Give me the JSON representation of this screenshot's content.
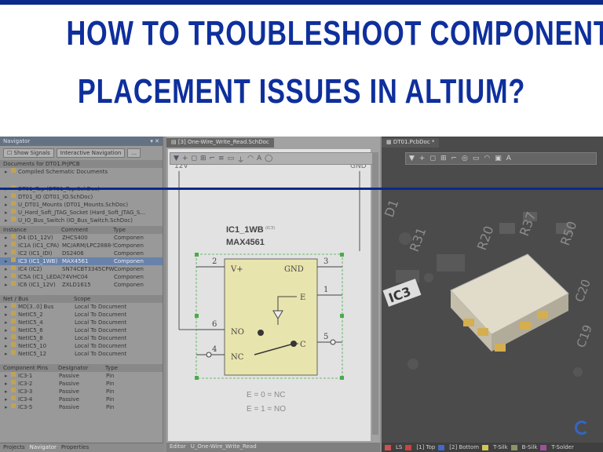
{
  "title": {
    "line1": "HOW TO TROUBLESHOOT COMPONENT",
    "line2": "PLACEMENT ISSUES IN ALTIUM?"
  },
  "colors": {
    "title": "#0e2f9c",
    "rule": "#0b2a8a",
    "selection": "#5f7fb0",
    "pcb_component": "#e8e2cc"
  },
  "navigator": {
    "header": "Navigator",
    "show_signals": "Show Signals",
    "interactive_nav": "Interactive Navigation",
    "more": "...",
    "documents_header": "Documents for DT01.PrjPCB",
    "compiled": "Compiled  Schematic Documents",
    "docs": [
      "DT01_Top (DT01_Top.SchDoc)",
      "DT01_IO (DT01_IO.SchDoc)",
      "U_DT01_Mounts (DT01_Mounts.SchDoc)",
      "U_Hard_Soft_JTAG_Socket (Hard_Soft_JTAG_S...",
      "U_IO_Bus_Switch (IO_Bus_Switch.SchDoc)"
    ],
    "instance_headers": [
      "Instance",
      "Comment",
      "Type"
    ],
    "instances": [
      [
        "D4 (D1_12V)",
        "ZHCS400",
        "Componen"
      ],
      [
        "IC1A (IC1_CPA)",
        "MC/ARM/LPC2888-5",
        "Componen"
      ],
      [
        "IC2 (IC1_IDI)",
        "DS2406",
        "Componen"
      ],
      [
        "IC3 (IC1_1WB)",
        "MAX4561",
        "Componen"
      ],
      [
        "IC4 (IC2)",
        "SN74CBT3345CPWR",
        "Componen"
      ],
      [
        "IC5A (IC1_LEDA)",
        "74VHC04",
        "Componen"
      ],
      [
        "IC6 (IC1_12V)",
        "ZXLD1615",
        "Componen"
      ]
    ],
    "net_headers": [
      "Net / Bus",
      "Scope"
    ],
    "nets": [
      [
        "MD[3..0] Bus",
        "Local To Document"
      ],
      [
        "NetIC5_2",
        "Local To Document"
      ],
      [
        "NetIC5_4",
        "Local To Document"
      ],
      [
        "NetIC5_6",
        "Local To Document"
      ],
      [
        "NetIC5_8",
        "Local To Document"
      ],
      [
        "NetIC5_10",
        "Local To Document"
      ],
      [
        "NetIC5_12",
        "Local To Document"
      ]
    ],
    "pin_headers": [
      "Component Pins",
      "Designator",
      "Type"
    ],
    "pins": [
      [
        "IC3-1",
        "Passive",
        "Pin"
      ],
      [
        "IC3-2",
        "Passive",
        "Pin"
      ],
      [
        "IC3-3",
        "Passive",
        "Pin"
      ],
      [
        "IC3-4",
        "Passive",
        "Pin"
      ],
      [
        "IC3-5",
        "Passive",
        "Pin"
      ]
    ],
    "bottom_tabs": [
      "Projects",
      "Navigator",
      "Properties"
    ]
  },
  "schematic": {
    "tab": "[3] One-Wire_Write_Read.SchDoc",
    "net_left": "12V",
    "net_right": "GND",
    "designator": "IC1_1WB",
    "designator_suffix": "(IC3)",
    "part": "MAX4561",
    "pins": {
      "p2": "2",
      "p3": "3",
      "p1": "1",
      "p6": "6",
      "p5": "5",
      "p4": "4",
      "vplus": "V+",
      "gnd": "GND",
      "e": "E",
      "no": "NO",
      "nc": "NC",
      "c": "C"
    },
    "truth1": "E = 0 = NC",
    "truth2": "E = 1 = NO",
    "status_editor": "Editor",
    "status_doc": "U_One-Wire_Write_Read"
  },
  "pcb": {
    "tab": "DT01.PcbDoc *",
    "labels": [
      "D1",
      "R31",
      "R20",
      "R37",
      "R50",
      "IC3",
      "C20",
      "C19"
    ],
    "status_layers": [
      "LS",
      "[1] Top",
      "[2] Bottom",
      "T-Silk",
      "B-Silk",
      "T-Solder"
    ]
  }
}
